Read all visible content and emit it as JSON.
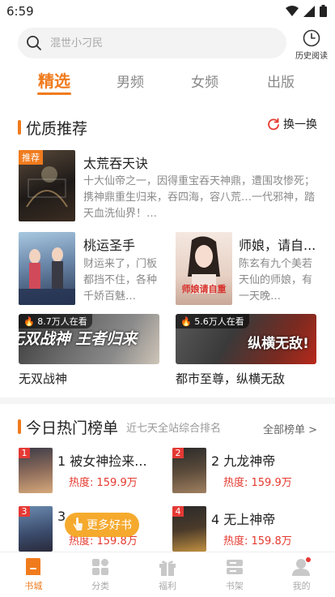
{
  "status": {
    "time": "6:59"
  },
  "search": {
    "placeholder": "混世小刁民",
    "history_label": "历史阅读"
  },
  "tabs": [
    {
      "label": "精选",
      "active": true
    },
    {
      "label": "男频"
    },
    {
      "label": "女频"
    },
    {
      "label": "出版"
    }
  ],
  "featured": {
    "title": "优质推荐",
    "refresh_label": "换一换",
    "top_book": {
      "tag": "推荐",
      "title": "太荒吞天诀",
      "desc": "十大仙帝之一，因得重宝吞天神鼎，遭围攻惨死；携神鼎重生归来，吞四海，容八荒…一代邪神，踏天血洗仙界！…"
    },
    "books": [
      {
        "title": "桃运圣手",
        "desc": "财运来了，门板都挡不住，各种千娇百魅…"
      },
      {
        "title": "师娘，请自...",
        "desc": "陈玄有九个美若天仙的师娘，有一天晚…"
      }
    ],
    "banners": [
      {
        "reads": "8.7万人在看",
        "name": "无双战神",
        "cover_text": "无双战神 王者归来"
      },
      {
        "reads": "5.6万人在看",
        "name": "都市至尊，纵横无敌",
        "cover_text": "纵横无敌!"
      }
    ]
  },
  "hot": {
    "title": "今日热门榜单",
    "subtitle": "近七天全站综合排名",
    "all_label": "全部榜单 >",
    "items": [
      {
        "rank": "1",
        "title": "被女神捡来...",
        "heat": "热度: 159.9万"
      },
      {
        "rank": "2",
        "title": "九龙神帝",
        "heat": "热度: 159.9万"
      },
      {
        "rank": "3",
        "title": "...",
        "heat": "热度: 159.8万"
      },
      {
        "rank": "4",
        "title": "无上神帝",
        "heat": "热度: 159.8万"
      }
    ],
    "more_label": "更多好书"
  },
  "nav": [
    {
      "label": "书城",
      "active": true
    },
    {
      "label": "分类"
    },
    {
      "label": "福利"
    },
    {
      "label": "书架"
    },
    {
      "label": "我的"
    }
  ],
  "colors": {
    "accent": "#f07b1d",
    "heat": "#e5392e"
  }
}
